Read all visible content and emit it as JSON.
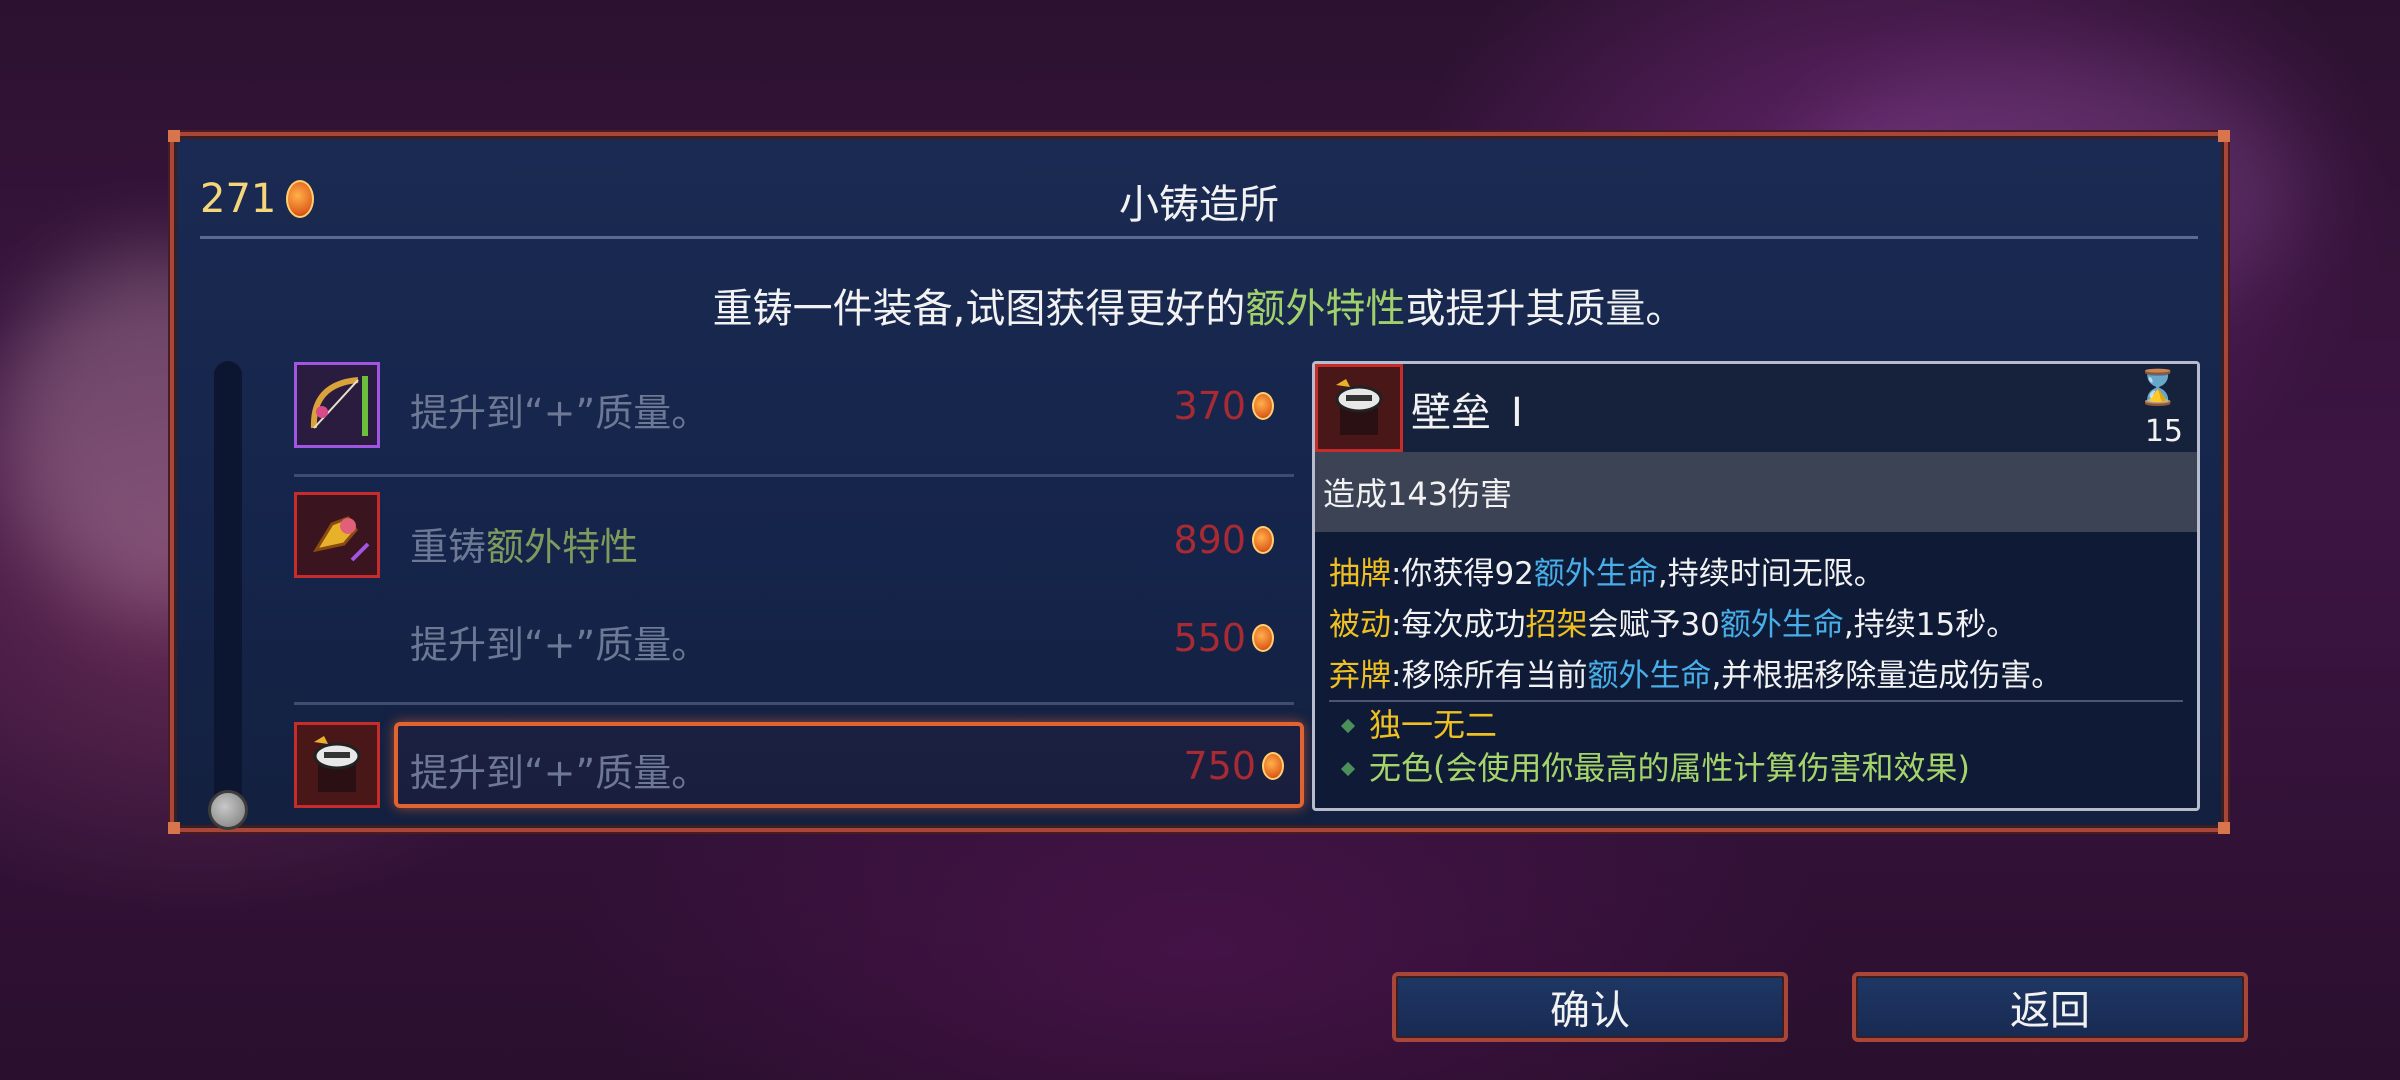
{
  "forge": {
    "title": "小铸造所",
    "gold": "271",
    "subtitle_before": "重铸一件装备,试图获得更好的",
    "subtitle_highlight": "额外特性",
    "subtitle_after": "或提升其质量。"
  },
  "options": [
    {
      "text": "提升到“+”质量。",
      "price": "370"
    },
    {
      "text_before": "重铸",
      "text_highlight": "额外特性",
      "price": "890"
    },
    {
      "text": "提升到“+”质量。",
      "price": "550"
    },
    {
      "text": "提升到“+”质量。",
      "price": "750"
    }
  ],
  "item": {
    "name": "壁垒",
    "level": "I",
    "timer": "15",
    "damage": "造成143伤害",
    "abilities": [
      {
        "keyword": "抽牌",
        "text_a": ":你获得92",
        "kw2": "额外生命",
        "text_b": ",持续时间无限。"
      },
      {
        "keyword": "被动",
        "text_a": ":每次成功",
        "kw_y": "招架",
        "text_c": "会赋予30",
        "kw2": "额外生命",
        "text_b": ",持续15秒。"
      },
      {
        "keyword": "弃牌",
        "text_a": ":移除所有当前",
        "kw2": "额外生命",
        "text_b": ",并根据移除量造成伤害。"
      }
    ],
    "tags": [
      "独一无二",
      "无色(会使用你最高的属性计算伤害和效果)"
    ]
  },
  "buttons": {
    "confirm": "确认",
    "back": "返回"
  },
  "colors": {
    "border": "#a8463a",
    "selected": "#e26330",
    "price": "#a82a32",
    "keyword_yellow": "#f0c020",
    "keyword_blue": "#48aee8",
    "highlight_green": "#9fd06a"
  },
  "icons": {
    "currency": "gold-coin-icon",
    "timer": "hourglass-icon"
  }
}
